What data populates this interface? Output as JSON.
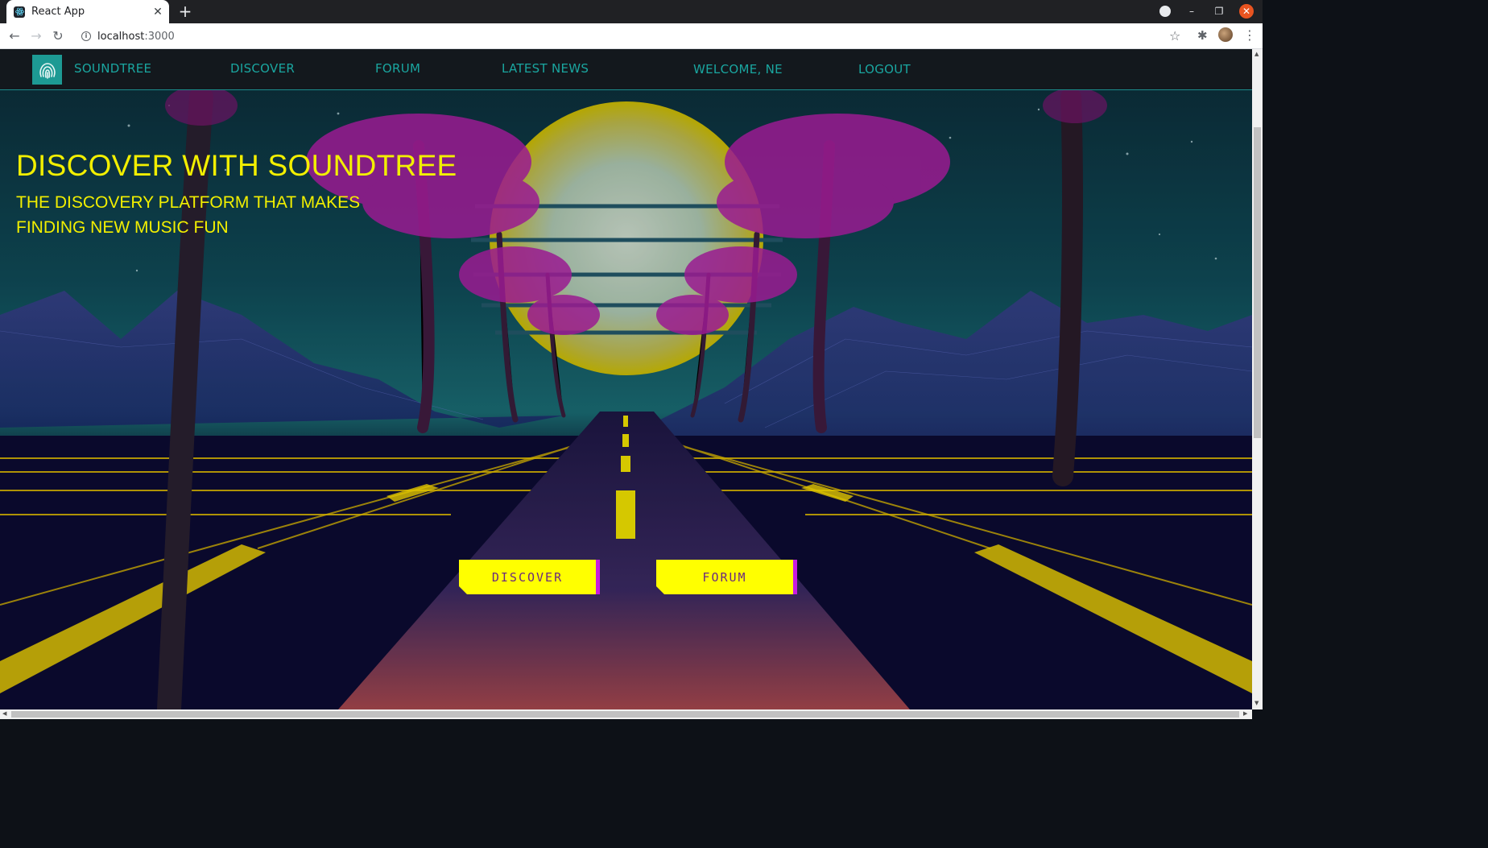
{
  "browser": {
    "tab_title": "React App",
    "url_host": "localhost",
    "url_port": ":3000"
  },
  "nav": {
    "brand": "SOUNDTREE",
    "links": [
      "DISCOVER",
      "FORUM",
      "LATEST NEWS"
    ],
    "welcome": "WELCOME, NE",
    "logout": "LOGOUT"
  },
  "hero": {
    "title": "DISCOVER WITH SOUNDTREE",
    "subtitle": "THE DISCOVERY PLATFORM THAT MAKES FINDING NEW MUSIC FUN"
  },
  "cta": {
    "discover": "DISCOVER",
    "forum": "FORUM"
  },
  "colors": {
    "accent_yellow": "#ffff00",
    "accent_magenta": "#c81be0",
    "nav_teal": "#1aa6a0"
  }
}
